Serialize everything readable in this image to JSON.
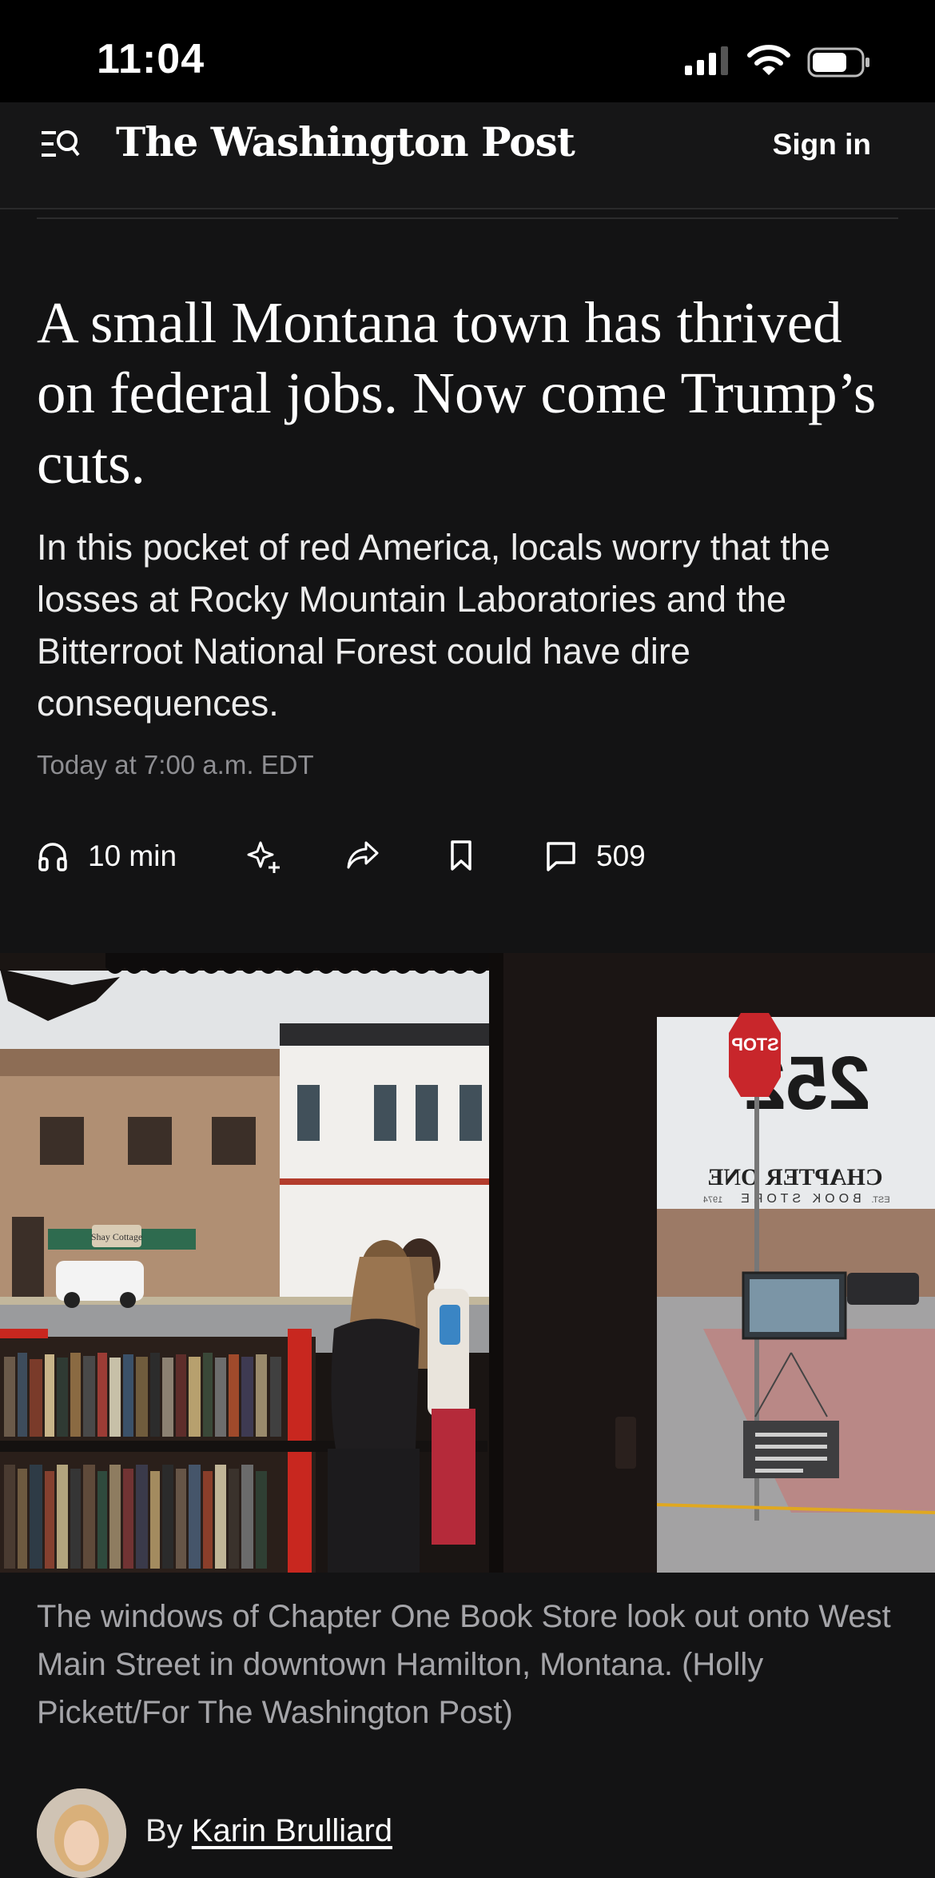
{
  "status_bar": {
    "time": "11:04"
  },
  "nav": {
    "logo": "The Washington Post",
    "sign_in": "Sign in"
  },
  "article": {
    "headline": "A small Montana town has thrived on federal jobs. Now come Trump’s cuts.",
    "dek": "In this pocket of red America, locals worry that the losses at Rocky Mountain Laboratories and the Bitterroot National Forest could have dire consequences.",
    "timestamp": "Today at 7:00 a.m. EDT",
    "actions": {
      "listen_label": "10 min",
      "comment_count": "509"
    },
    "photo_sign_text": {
      "number": "252",
      "store_name": "CHAPTER ONE",
      "store_sub": "BOOK STORE",
      "est": "EST.",
      "year": "1974",
      "stop": "STOP",
      "cafe_sign": "Shay Cottage"
    },
    "caption": "The windows of Chapter One Book Store look out onto West Main Street in downtown Hamilton, Montana. (Holly Pickett/For The Washington Post)",
    "byline_prefix": "By ",
    "author": "Karin Brulliard"
  },
  "colors": {
    "background": "#131314",
    "status_bar": "#000000",
    "text_primary": "#ffffff",
    "text_muted": "#8e8e92",
    "caption_text": "#a5a5a9"
  }
}
